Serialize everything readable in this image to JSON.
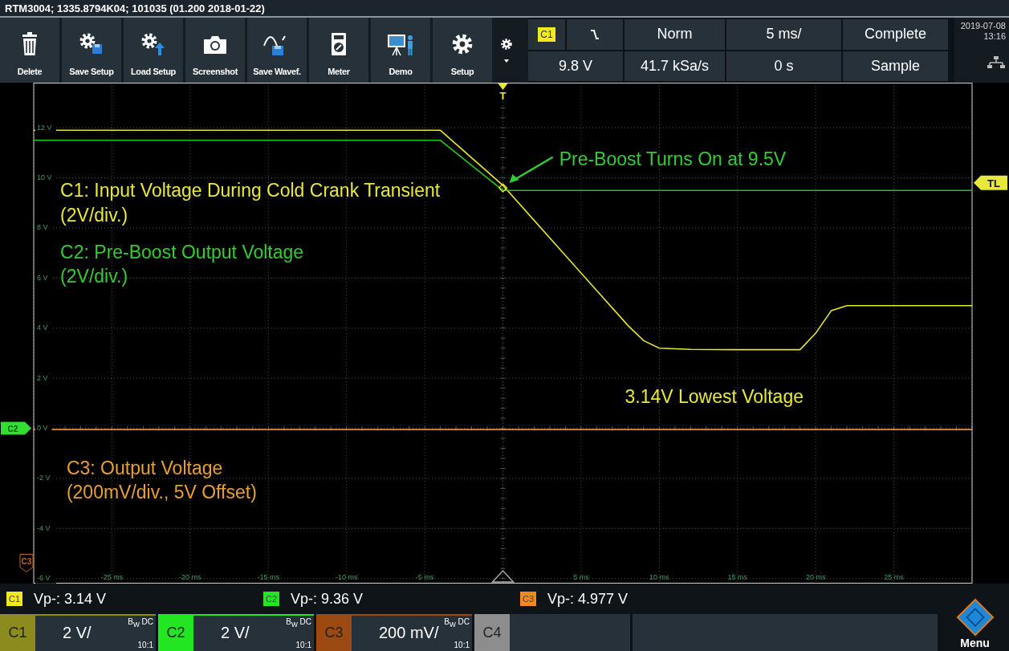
{
  "title_bar": {
    "text": "RTM3004; 1335.8794K04; 101035 (01.200 2018-01-22)"
  },
  "toolbar": [
    {
      "label": "Delete"
    },
    {
      "label": "Save Setup"
    },
    {
      "label": "Load Setup"
    },
    {
      "label": "Screenshot"
    },
    {
      "label": "Save Wavef."
    },
    {
      "label": "Meter"
    },
    {
      "label": "Demo"
    },
    {
      "label": "Setup"
    }
  ],
  "trigger": {
    "source": "C1",
    "level": "9.8 V",
    "mode": "Norm",
    "sample_rate": "41.7 kSa/s",
    "timebase": "5 ms/",
    "position": "0 s",
    "acquisition": "Complete",
    "sampling": "Sample"
  },
  "clock": {
    "date": "2019-07-08",
    "time": "13:16"
  },
  "display": {
    "chart_data": {
      "type": "line",
      "grid": true,
      "xlim": [
        -30,
        30
      ],
      "ylim": [
        -6.2,
        13.8
      ],
      "x": [
        -30,
        -20,
        -10,
        -4,
        0,
        2,
        4,
        6,
        8,
        9,
        10,
        12,
        15,
        19,
        20,
        21,
        22,
        25,
        30
      ],
      "series": [
        {
          "color": "#e6e62a",
          "values": [
            11.9,
            11.9,
            11.9,
            11.9,
            9.7,
            8.3,
            6.9,
            5.5,
            4.1,
            3.5,
            3.2,
            3.15,
            3.14,
            3.14,
            3.8,
            4.7,
            4.9,
            4.9,
            4.9
          ]
        },
        {
          "color": "#22c322",
          "values": [
            11.5,
            11.5,
            11.5,
            11.5,
            9.5,
            9.5,
            9.5,
            9.5,
            9.5,
            9.5,
            9.5,
            9.5,
            9.5,
            9.5,
            9.5,
            9.5,
            9.5,
            9.5,
            9.5
          ]
        },
        {
          "color": "#f08a24",
          "values": [
            -0.05,
            -0.05,
            -0.05,
            -0.05,
            -0.05,
            -0.05,
            -0.05,
            -0.05,
            -0.05,
            -0.05,
            -0.05,
            -0.05,
            -0.05,
            -0.05,
            -0.05,
            -0.05,
            -0.05,
            -0.05,
            -0.05
          ]
        }
      ],
      "xticks": [
        {
          "value": -25,
          "label": "-25 ms"
        },
        {
          "value": -20,
          "label": "-20 ms"
        },
        {
          "value": -15,
          "label": "-15 ms"
        },
        {
          "value": -10,
          "label": "-10 ms"
        },
        {
          "value": -5,
          "label": "-5 ms"
        },
        {
          "value": 5,
          "label": "5 ms"
        },
        {
          "value": 10,
          "label": "10 ms"
        },
        {
          "value": 15,
          "label": "15 ms"
        },
        {
          "value": 20,
          "label": "20 ms"
        },
        {
          "value": 25,
          "label": "25 ms"
        }
      ],
      "yticks": [
        {
          "value": 12,
          "label": "12 V"
        },
        {
          "value": 10,
          "label": "10 V"
        },
        {
          "value": 8,
          "label": "8 V"
        },
        {
          "value": 6,
          "label": "6 V"
        },
        {
          "value": 4,
          "label": "4 V"
        },
        {
          "value": 2,
          "label": "2 V"
        },
        {
          "value": 0,
          "label": "0 V"
        },
        {
          "value": -2,
          "label": "-2 V"
        },
        {
          "value": -4,
          "label": "-4 V"
        },
        {
          "value": -6,
          "label": "-6 V"
        }
      ]
    },
    "markers": [
      {
        "kind": "trigger",
        "text": "T"
      },
      {
        "kind": "level",
        "text": "TL"
      },
      {
        "kind": "channel",
        "text": "C2"
      },
      {
        "kind": "channel_outline",
        "text": "C3"
      }
    ],
    "labels": [
      {
        "kind": "callout",
        "text": "Pre-Boost Turns On at 9.5V",
        "color": "#33cc33"
      },
      {
        "kind": "text",
        "text": "C1: Input Voltage During Cold Crank Transient",
        "color": "#e8e83a"
      },
      {
        "kind": "text",
        "text": "(2V/div.)",
        "color": "#e8e83a"
      },
      {
        "kind": "text",
        "text": "C2: Pre-Boost Output Voltage",
        "color": "#33cc33"
      },
      {
        "kind": "text",
        "text": "(2V/div.)",
        "color": "#33cc33"
      },
      {
        "kind": "text",
        "text": "3.14V Lowest Voltage",
        "color": "#e8e83a"
      },
      {
        "kind": "text",
        "text": "C3: Output Voltage",
        "color": "#e8a030"
      },
      {
        "kind": "text",
        "text": "(200mV/div., 5V Offset)",
        "color": "#e8a030"
      }
    ]
  },
  "measurements": [
    {
      "channel": "C1",
      "color": "#f2ea1c",
      "text": "Vp-: 3.14 V"
    },
    {
      "channel": "C2",
      "color": "#22e622",
      "text": "Vp-: 9.36 V"
    },
    {
      "channel": "C3",
      "color": "#f08a1e",
      "text": "Vp-: 4.977 V"
    }
  ],
  "channels": [
    {
      "label": "C1",
      "on": true,
      "color": "#8c8c1e",
      "scale": "2 V/",
      "bandwidth": "B$_{W}$ DC",
      "probe": "10:1"
    },
    {
      "label": "C2",
      "on": true,
      "color": "#22e622",
      "scale": "2 V/",
      "bandwidth": "B$_{W}$ DC",
      "probe": "10:1"
    },
    {
      "label": "C3",
      "on": true,
      "color": "#9c4a12",
      "scale": "200 mV/",
      "bandwidth": "B$_{W}$ DC",
      "probe": "10:1"
    },
    {
      "label": "C4",
      "on": false
    }
  ],
  "menu_button": {
    "label": "Menu"
  }
}
